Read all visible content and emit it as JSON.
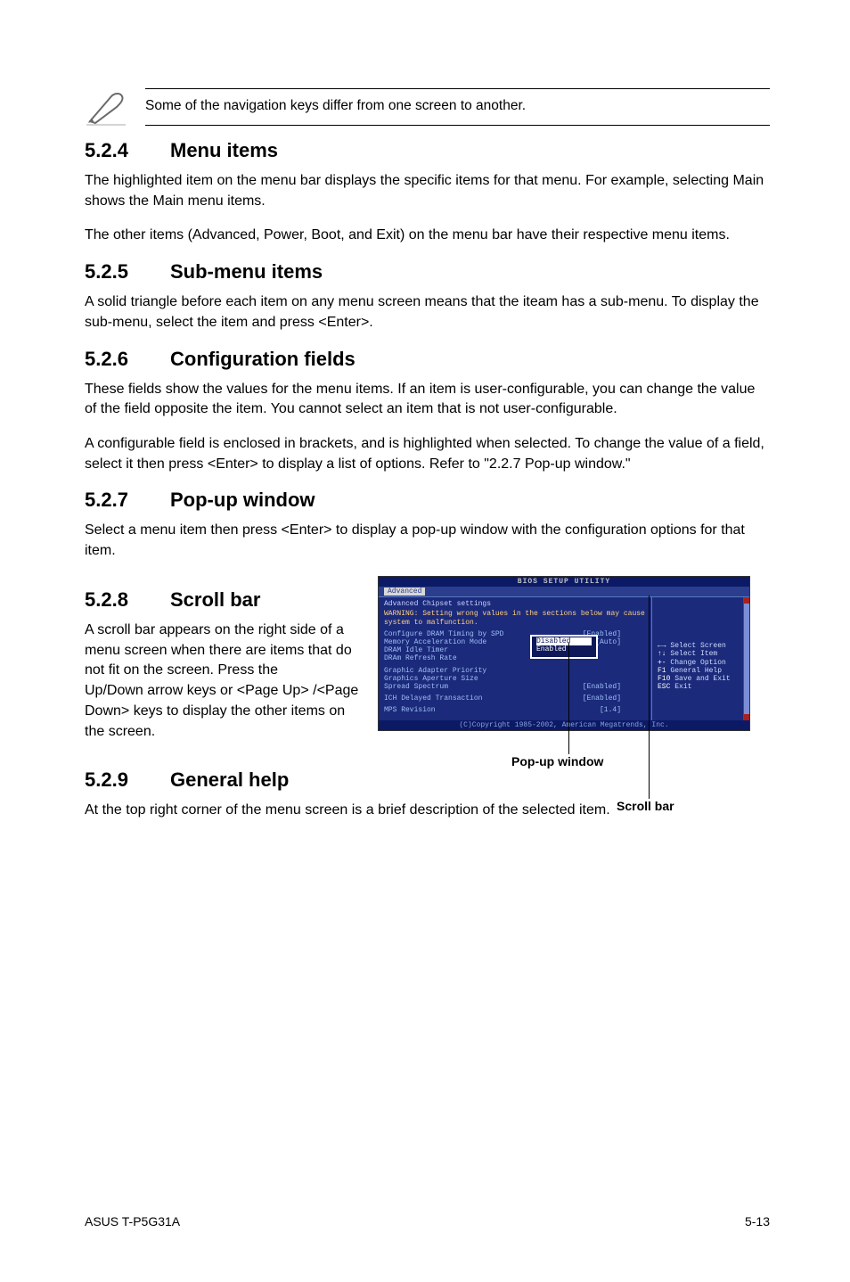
{
  "note": {
    "text": "Some of the navigation keys differ from one screen to another."
  },
  "sections": {
    "s524": {
      "num": "5.2.4",
      "title": "Menu items",
      "p1": "The highlighted item on the menu bar  displays the specific items for that menu. For example, selecting Main shows the Main menu items.",
      "p2": "The other items (Advanced, Power, Boot, and Exit) on the menu bar have their respective menu items."
    },
    "s525": {
      "num": "5.2.5",
      "title": "Sub-menu items",
      "p1": "A solid triangle before each item on any menu screen means that the iteam has a sub-menu. To display the sub-menu, select the item and press <Enter>."
    },
    "s526": {
      "num": "5.2.6",
      "title": "Configuration fields",
      "p1": "These fields show the values for the menu items. If an item is user-configurable, you can change the value of the field opposite the item. You cannot select an item that is not user-configurable.",
      "p2": "A configurable field is enclosed in brackets, and is highlighted when selected. To change the value of a field, select it then press <Enter> to display a list of options. Refer to \"2.2.7 Pop-up window.\""
    },
    "s527": {
      "num": "5.2.7",
      "title": "Pop-up window",
      "p1": "Select a menu item then press <Enter> to display a pop-up window with the configuration options for that item."
    },
    "s528": {
      "num": "5.2.8",
      "title": "Scroll bar",
      "p1": "A scroll bar appears on the right side of a menu screen when there are items that do not fit on the screen. Press the",
      "p2": "Up/Down arrow keys or <Page Up> /<Page Down> keys to display the other items on the screen."
    },
    "s529": {
      "num": "5.2.9",
      "title": "General help",
      "p1": "At the top right corner of the menu screen is a brief description of the selected item."
    }
  },
  "bios": {
    "title": "BIOS SETUP UTILITY",
    "tab": "Advanced",
    "panel_header": "Advanced Chipset settings",
    "warning": "WARNING: Setting wrong values in the sections below may cause system to malfunction.",
    "rows": [
      {
        "label": "Configure DRAM Timing by SPD",
        "value": "[Enabled]"
      },
      {
        "label": "Memory Acceleration Mode",
        "value": "[Auto]"
      },
      {
        "label": "DRAM Idle Timer",
        "value": ""
      },
      {
        "label": "DRAm Refresh Rate",
        "value": ""
      },
      {
        "label": "Graphic Adapter Priority",
        "value": ""
      },
      {
        "label": "Graphics Aperture Size",
        "value": ""
      },
      {
        "label": "Spread Spectrum",
        "value": "[Enabled]"
      },
      {
        "label": "ICH Delayed Transaction",
        "value": "[Enabled]"
      },
      {
        "label": "MPS Revision",
        "value": "[1.4]"
      }
    ],
    "popup": {
      "opt1": "Disabled",
      "opt2": "Enabled"
    },
    "help": [
      {
        "key": "←→",
        "txt": "Select Screen"
      },
      {
        "key": "↑↓",
        "txt": "Select Item"
      },
      {
        "key": "+-",
        "txt": "Change Option"
      },
      {
        "key": "F1",
        "txt": "General Help"
      },
      {
        "key": "F10",
        "txt": "Save and Exit"
      },
      {
        "key": "ESC",
        "txt": "Exit"
      }
    ],
    "footer": "(C)Copyright 1985-2002, American Megatrends, Inc."
  },
  "callouts": {
    "popup": "Pop-up window",
    "scrollbar": "Scroll bar"
  },
  "page_footer": {
    "left": "ASUS T-P5G31A",
    "right": "5-13"
  }
}
